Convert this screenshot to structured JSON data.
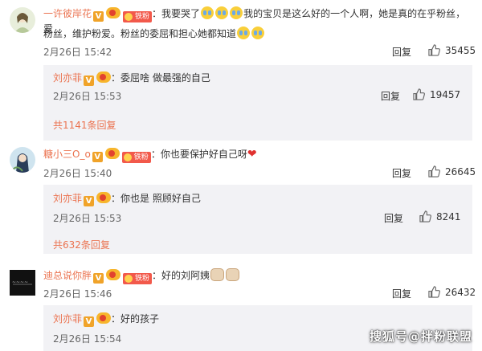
{
  "comments": [
    {
      "user": "一许彼岸花",
      "fan_badge": "铁粉",
      "colon": "：",
      "text_a": "我要哭了",
      "text_b": "我的宝贝是这么好的一个人啊，她是真的在乎粉丝，爱",
      "text_line2": "粉丝，维护粉爱。粉丝的委屈和担心她都知道",
      "time": "2月26日 15:42",
      "reply_label": "回复",
      "likes": "35455",
      "sub": {
        "user": "刘亦菲",
        "colon": "：",
        "text": "委屈啥 做最强的自己",
        "time": "2月26日 15:53",
        "reply_label": "回复",
        "likes": "19457"
      },
      "more": "共1141条回复"
    },
    {
      "user": "糖小三O_o",
      "fan_badge": "铁粉",
      "colon": "：",
      "text": "你也要保护好自己呀",
      "time": "2月26日 15:40",
      "reply_label": "回复",
      "likes": "26645",
      "sub": {
        "user": "刘亦菲",
        "colon": "：",
        "text": "你也是 照顾好自己",
        "time": "2月26日 15:53",
        "reply_label": "回复",
        "likes": "8241"
      },
      "more": "共632条回复"
    },
    {
      "user": "迪总说你胖",
      "fan_badge": "铁粉",
      "colon": "：",
      "text": "好的刘阿姨",
      "time": "2月26日 15:46",
      "reply_label": "回复",
      "likes": "26432",
      "sub": {
        "user": "刘亦菲",
        "colon": "：",
        "text": "好的孩子",
        "time": "2月26日 15:54"
      }
    }
  ],
  "vip_letter": "V",
  "watermark": "搜狐号@拌粉联盟",
  "colors": {
    "username": "#eb7350",
    "sub_bg": "#f2f2f5",
    "fan_badge": "#f2594b",
    "vip": "#f0a329"
  }
}
